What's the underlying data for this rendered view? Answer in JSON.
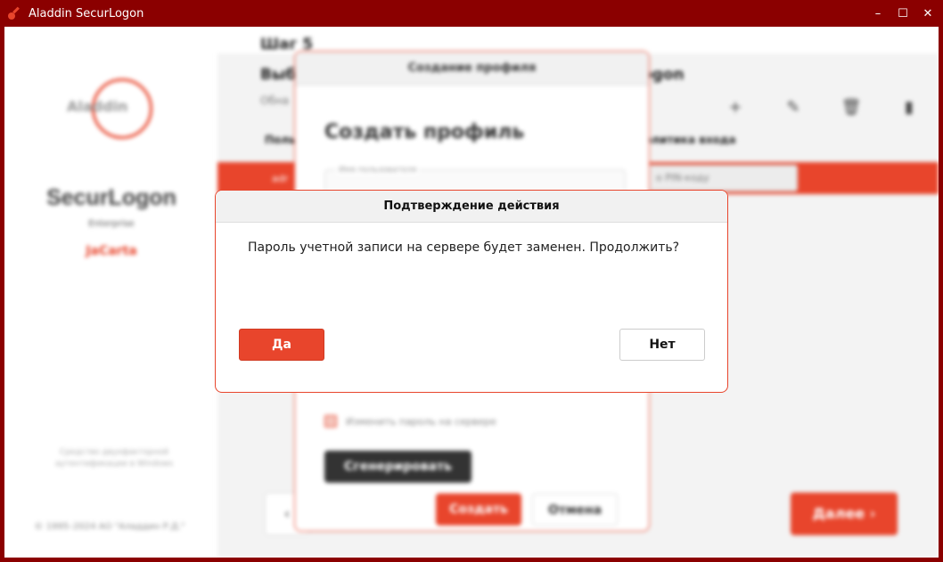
{
  "window": {
    "title": "Aladdin SecurLogon",
    "controls": {
      "minimize": "–",
      "maximize": "☐",
      "close": "✕"
    }
  },
  "sidebar": {
    "logo_text": "Aladdin",
    "product": "SecurLogon",
    "edition": "Enterprise",
    "variant": "JaCarta",
    "note": "Средство двухфакторной аутентификации в Windows",
    "copyright": "© 1995–2024 АО \"Аладдин Р.Д.\""
  },
  "main": {
    "step": "Шаг 5",
    "heading_start": "Выб",
    "heading_end": "ogon",
    "subheading": "Обна",
    "columns": {
      "user": "Поль",
      "policy": "олитика входа"
    },
    "selected_row": {
      "user": "adr",
      "policy": "о PIN-коду"
    },
    "toolbar": {
      "add": "+",
      "edit": "✎",
      "delete": "🗑",
      "token": "▮"
    },
    "back_label": "‹",
    "next_label": "Далее  ›"
  },
  "profile_dialog": {
    "title": "Создание профиля",
    "heading": "Создать профиль",
    "user_field_label": "Имя пользователя",
    "checkbox_label": "Изменить пароль на сервере",
    "generate_label": "Сгенерировать",
    "create_label": "Создать",
    "cancel_label": "Отмена"
  },
  "confirm_dialog": {
    "title": "Подтверждение действия",
    "message": "Пароль учетной записи на сервере будет заменен. Продолжить?",
    "yes_label": "Да",
    "no_label": "Нет"
  },
  "colors": {
    "accent": "#e8452c",
    "titlebar": "#8b0000"
  }
}
